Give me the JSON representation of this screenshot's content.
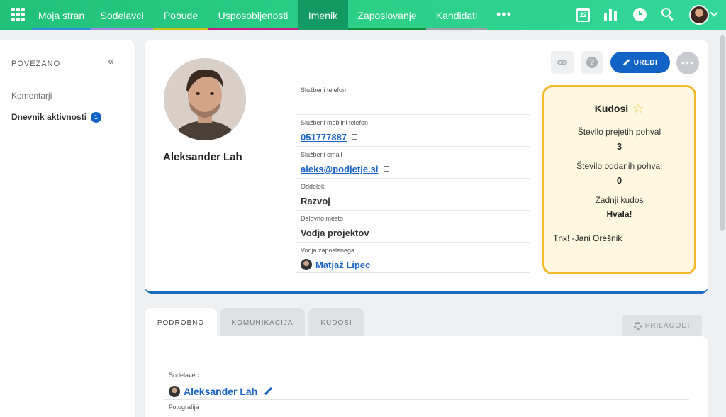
{
  "nav": {
    "items": [
      {
        "label": "Moja stran",
        "color": "#2f8fd8",
        "width": 83
      },
      {
        "label": "Sodelavci",
        "color": "#a38ae6",
        "width": 88
      },
      {
        "label": "Pobude",
        "color": "#cfc018",
        "width": 78
      },
      {
        "label": "Usposobljenosti",
        "color": "#c21f8a",
        "width": 126
      },
      {
        "label": "Imenik",
        "color": "#1a9c62",
        "width": 71,
        "active": true
      },
      {
        "label": "Zaposlovanje",
        "color": "#0d8f3a",
        "width": 110
      },
      {
        "label": "Kandidati",
        "color": "#9aa0a6",
        "width": 86
      }
    ],
    "more": "•••",
    "calendar_day": "22",
    "icons": [
      "apps-grid-icon",
      "calendar-icon",
      "chart-icon",
      "clock-icon",
      "search-icon",
      "chevron-down-icon"
    ]
  },
  "sidebar": {
    "title": "POVEZANO",
    "collapse": "«",
    "items": [
      {
        "label": "Komentarji"
      },
      {
        "label": "Dnevnik aktivnosti",
        "count": "1"
      }
    ]
  },
  "profile": {
    "name": "Aleksander Lah",
    "fields": [
      {
        "label": "Službeni telefon",
        "value": ""
      },
      {
        "label": "Službeni mobilni telefon",
        "value": "051777887",
        "link": true,
        "copy": true
      },
      {
        "label": "Službeni email",
        "value": "aleks@podjetje.si",
        "link": true,
        "copy": true
      },
      {
        "label": "Oddelek",
        "value": "Razvoj"
      },
      {
        "label": "Delovno mesto",
        "value": "Vodja projektov"
      },
      {
        "label": "Vodja zaposlenega",
        "value": "Matjaž Lipec",
        "link": true,
        "avatar": true
      }
    ]
  },
  "actions": {
    "edit": "UREDI",
    "help": "?",
    "more": "•••"
  },
  "kudos": {
    "title": "Kudosi",
    "star": "☆",
    "received_label": "Število prejetih pohval",
    "received_value": "3",
    "given_label": "Število oddanih pohval",
    "given_value": "0",
    "last_label": "Zadnji kudos",
    "last_value": "Hvala!",
    "message": "Tnx! -Jani Orešnik"
  },
  "tabs": [
    {
      "label": "PODROBNO",
      "active": true
    },
    {
      "label": "KOMUNIKACIJA"
    },
    {
      "label": "KUDOSI"
    }
  ],
  "customize": "PRILAGODI",
  "details": {
    "coworker_label": "Sodelavec",
    "coworker_value": "Aleksander Lah",
    "photo_label": "Fotografija"
  },
  "colors": {
    "accent": "#1363c6",
    "brand_green": "#2bcf86",
    "kudos_border": "#f5b82e",
    "kudos_bg": "#fff7df"
  }
}
